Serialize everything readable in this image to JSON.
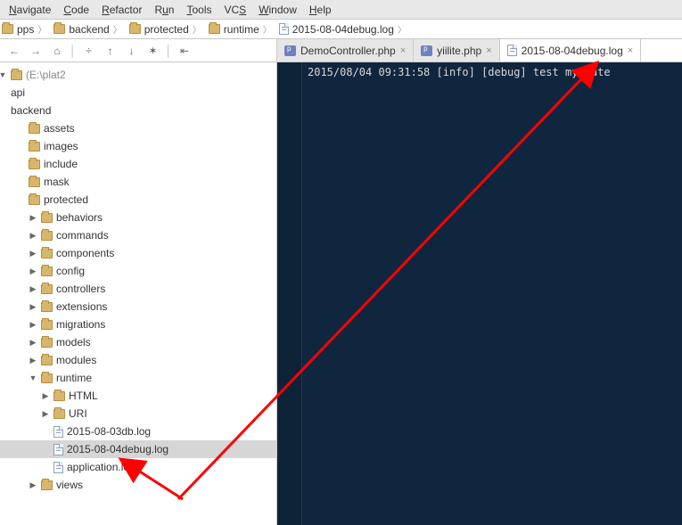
{
  "menu": {
    "navigate": "Navigate",
    "code": "Code",
    "refactor": "Refactor",
    "run": "Run",
    "tools": "Tools",
    "vcs": "VCS",
    "window": "Window",
    "help": "Help"
  },
  "breadcrumbs": [
    {
      "icon": "folder",
      "label": "pps"
    },
    {
      "icon": "folder",
      "label": "backend"
    },
    {
      "icon": "folder",
      "label": "protected"
    },
    {
      "icon": "folder",
      "label": "runtime"
    },
    {
      "icon": "file",
      "label": "2015-08-04debug.log"
    }
  ],
  "toolbar_icons": [
    "back",
    "fwd",
    "home",
    "divider",
    "slash",
    "up",
    "down",
    "gear",
    "divider",
    "collapse"
  ],
  "tabs": [
    {
      "icon": "php",
      "label": "DemoController.php",
      "active": false
    },
    {
      "icon": "php",
      "label": "yiilite.php",
      "active": false
    },
    {
      "icon": "file",
      "label": "2015-08-04debug.log",
      "active": true
    }
  ],
  "tree": {
    "root_label": "(E:\\plat2",
    "nodes": [
      {
        "depth": 0,
        "toggle": "v",
        "icon": "folder",
        "label": "(E:\\plat2",
        "root": true
      },
      {
        "depth": 0,
        "toggle": "",
        "icon": "",
        "label": "api"
      },
      {
        "depth": 0,
        "toggle": "",
        "icon": "",
        "label": "backend"
      },
      {
        "depth": 1,
        "toggle": "",
        "icon": "folder",
        "label": "assets"
      },
      {
        "depth": 1,
        "toggle": "",
        "icon": "folder",
        "label": "images"
      },
      {
        "depth": 1,
        "toggle": "",
        "icon": "folder",
        "label": "include"
      },
      {
        "depth": 1,
        "toggle": "",
        "icon": "folder",
        "label": "mask"
      },
      {
        "depth": 1,
        "toggle": "",
        "icon": "folder",
        "label": "protected"
      },
      {
        "depth": 2,
        "toggle": ">",
        "icon": "folder",
        "label": "behaviors"
      },
      {
        "depth": 2,
        "toggle": ">",
        "icon": "folder",
        "label": "commands"
      },
      {
        "depth": 2,
        "toggle": ">",
        "icon": "folder",
        "label": "components"
      },
      {
        "depth": 2,
        "toggle": ">",
        "icon": "folder",
        "label": "config"
      },
      {
        "depth": 2,
        "toggle": ">",
        "icon": "folder",
        "label": "controllers"
      },
      {
        "depth": 2,
        "toggle": ">",
        "icon": "folder",
        "label": "extensions"
      },
      {
        "depth": 2,
        "toggle": ">",
        "icon": "folder",
        "label": "migrations"
      },
      {
        "depth": 2,
        "toggle": ">",
        "icon": "folder",
        "label": "models"
      },
      {
        "depth": 2,
        "toggle": ">",
        "icon": "folder",
        "label": "modules"
      },
      {
        "depth": 2,
        "toggle": "v",
        "icon": "folder",
        "label": "runtime"
      },
      {
        "depth": 3,
        "toggle": ">",
        "icon": "folder",
        "label": "HTML"
      },
      {
        "depth": 3,
        "toggle": ">",
        "icon": "folder",
        "label": "URI"
      },
      {
        "depth": 3,
        "toggle": "",
        "icon": "file",
        "label": "2015-08-03db.log"
      },
      {
        "depth": 3,
        "toggle": "",
        "icon": "file",
        "label": "2015-08-04debug.log",
        "selected": true
      },
      {
        "depth": 3,
        "toggle": "",
        "icon": "file",
        "label": "application.log"
      },
      {
        "depth": 2,
        "toggle": ">",
        "icon": "folder",
        "label": "views",
        "faded": true
      }
    ]
  },
  "editor": {
    "line1": "2015/08/04 09:31:58 [info] [debug] test my cate"
  },
  "glyphs": {
    "back": "←",
    "fwd": "→",
    "home": "⌂",
    "slash": "÷",
    "up": "↑",
    "down": "↓",
    "gear": "✶",
    "collapse": "⇤",
    "divider": "│",
    "toggle_open": "▼",
    "toggle_closed": "▶",
    "close": "×",
    "crumb_sep": "〉"
  }
}
